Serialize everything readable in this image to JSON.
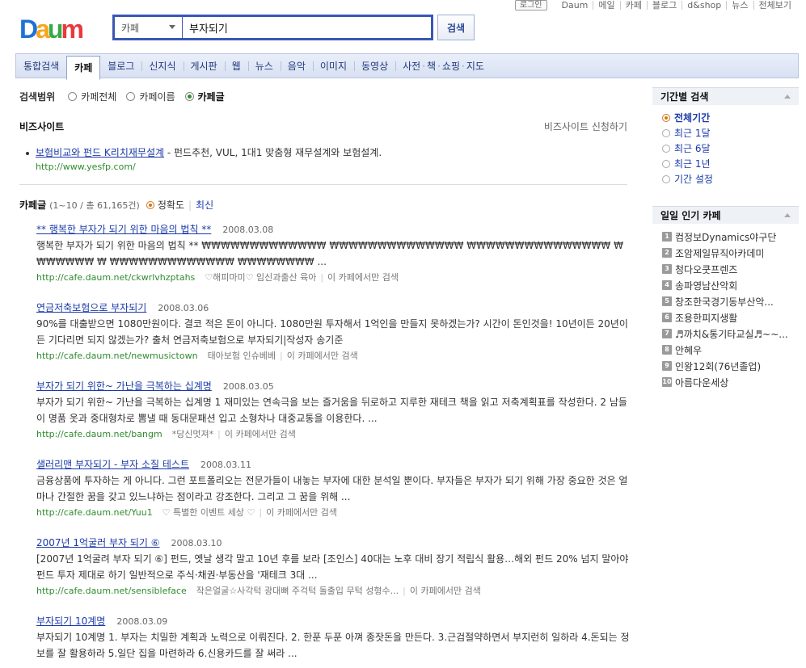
{
  "toplinks": {
    "login": "로그인",
    "items": [
      "Daum",
      "메일",
      "카페",
      "블로그",
      "d&shop",
      "뉴스",
      "전체보기"
    ]
  },
  "logo": {
    "text": "Daum"
  },
  "search": {
    "scope": "카페",
    "query": "부자되기",
    "button": "검색"
  },
  "tabs": [
    "통합검색",
    "카페",
    "블로그",
    "신지식",
    "게시판",
    "웹",
    "뉴스",
    "음악",
    "이미지",
    "동영상"
  ],
  "tab_group": [
    "사전",
    "책",
    "쇼핑",
    "지도"
  ],
  "active_tab": "카페",
  "scope_filter": {
    "label": "검색범위",
    "options": [
      "카페전체",
      "카페이름",
      "카페글"
    ],
    "selected": "카페글"
  },
  "biz": {
    "title": "비즈사이트",
    "apply": "비즈사이트 신청하기",
    "item_title": "보험비교와 펀드 K리치재무설계",
    "item_desc": " - 펀드추천, VUL, 1대1 맞춤형 재무설계와 보험설계.",
    "item_url": "http://www.yesfp.com/"
  },
  "results_header": {
    "title": "카페글",
    "count": "(1~10 / 총 61,165건)",
    "sort_accuracy": "정확도",
    "sort_latest": "최신"
  },
  "results": [
    {
      "title": "** 행복한 부자가 되기 위한 마음의 법칙 **",
      "date": "2008.03.08",
      "snippet": "행복한 부자가 되기 위한 마음의 법칙 ** ₩₩₩₩₩₩₩₩₩₩₩₩₩ ₩₩₩₩₩₩₩₩₩₩₩₩₩₩ ₩₩₩₩₩₩₩₩₩₩₩₩₩₩₩ ₩₩₩₩₩₩₩ ₩ ₩₩₩₩₩₩₩₩₩₩₩₩₩ ₩₩₩₩₩₩₩₩ ...",
      "url": "http://cafe.daum.net/ckwrlvhzptahs",
      "cafe": "♡해피마미♡ 임신과출산 육아",
      "only": "이 카페에서만 검색"
    },
    {
      "title": "연금저축보험으로 부자되기",
      "date": "2008.03.06",
      "snippet": "90%를 대출받으면 1080만원이다. 결코 적은 돈이 아니다. 1080만원 투자해서 1억인을 만들지 못하겠는가? 시간이 돈인것을! 10년이든 20년이든 기다리면 되지 않겠는가? 출처 연금저축보험으로 부자되기|작성자 송기준",
      "url": "http://cafe.daum.net/newmusictown",
      "cafe": "태아보험 인슈베베",
      "only": "이 카페에서만 검색"
    },
    {
      "title": "부자가 되기 위한~ 가난을 극복하는 십계명",
      "date": "2008.03.05",
      "snippet": "부자가 되기 위한~ 가난을 극복하는 십계명 1 재미있는 연속극을 보는 즐거움을 뒤로하고 지루한 재테크 책을 읽고 저축계획표를 작성한다. 2 남들이 명품 옷과 중대형차로 뽐낼 때 동대문패션 입고 소형차나 대중교통을 이용한다. ...",
      "url": "http://cafe.daum.net/bangm",
      "cafe": "*당신멋져*",
      "only": "이 카페에서만 검색"
    },
    {
      "title": "샐러리맨 부자되기 - 부자 소질 테스트",
      "date": "2008.03.11",
      "snippet": "금융상품에 투자하는 게 아니다. 그런 포트폴리오는 전문가들이 내놓는 부자에 대한 분석일 뿐이다. 부자들은 부자가 되기 위해 가장 중요한 것은 얼마나 간절한 꿈을 갖고 있느냐하는 점이라고 강조한다. 그리고 그 꿈을 위해 ...",
      "url": "http://cafe.daum.net/Yuu1",
      "cafe": "♡ 특별한 이벤트 세상 ♡",
      "only": "이 카페에서만 검색"
    },
    {
      "title": "2007년 1억굴러 부자 되기 ⑥",
      "date": "2008.03.10",
      "snippet": "[2007년 1억굴려 부자 되기 ⑥] 펀드, 옛날 생각 말고 10년 후를 보라 [조인스] 40대는 노후 대비 장기 적립식 활용…해외 펀드 20% 넘지 말아야 펀드 투자 제대로 하기 일반적으로 주식·채권·부동산을 '재테크 3대 ...",
      "url": "http://cafe.daum.net/sensibleface",
      "cafe": "작은얼굴☆사각턱 광대뼈 주걱턱 돌출입 무턱 성형수...",
      "only": "이 카페에서만 검색"
    },
    {
      "title": "부자되기 10계명",
      "date": "2008.03.09",
      "snippet": "부자되기 10계명 1. 부자는 치밀한 계획과 노력으로 이뤄진다. 2. 한푼 두푼 아껴 종잣돈을 만든다. 3.근검절약하면서 부지런히 일하라 4.돈되는 정보를 잘 활용하라 5.일단 집을 마련하라 6.신용카드를 잘 써라 ...",
      "url": "",
      "cafe": "",
      "only": ""
    }
  ],
  "side": {
    "period_title": "기간별 검색",
    "period_options": [
      "전체기간",
      "최근 1달",
      "최근 6달",
      "최근 1년",
      "기간 설정"
    ],
    "period_selected": "전체기간",
    "popular_title": "일일 인기 카페",
    "popular": [
      "컴정보Dynamics야구단",
      "조암제일뮤직아카데미",
      "청다오쿳프렌즈",
      "송파영남산악회",
      "창조한국경기동부산악...",
      "조용한피지생활",
      "♬까치&통기타교실♬~~...",
      "안혜우",
      "인왕12회(76년졸업)",
      "아름다운세상"
    ]
  },
  "colors": {
    "link": "#1a3aa8",
    "url_green": "#2f8b2f",
    "search_border": "#3a57b3",
    "tab_bg": "#dfe6f5"
  }
}
